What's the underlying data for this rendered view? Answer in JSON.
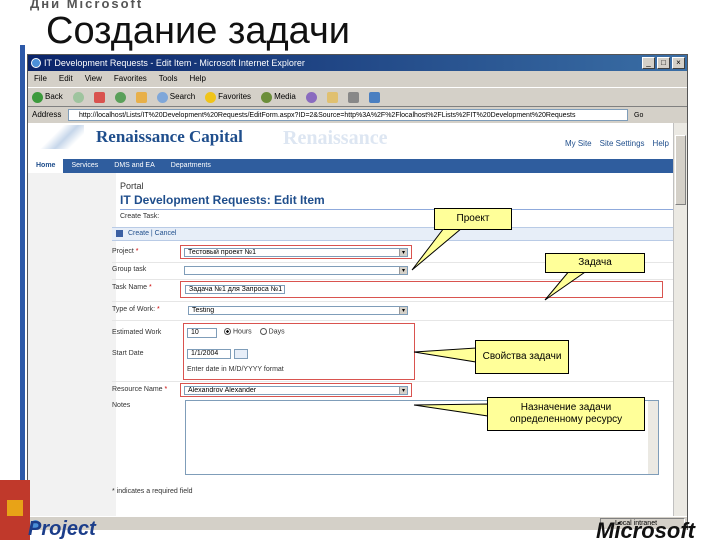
{
  "slide": {
    "header_small": "Дни Microsoft",
    "title": "Создание задачи",
    "footer_left": "Project",
    "footer_right": "Microsoft"
  },
  "browser": {
    "window_title": "IT Development Requests - Edit Item - Microsoft Internet Explorer",
    "menu": [
      "File",
      "Edit",
      "View",
      "Favorites",
      "Tools",
      "Help"
    ],
    "toolbar": [
      "Back",
      "",
      "",
      "",
      "",
      "Search",
      "Favorites",
      "Media",
      "",
      "",
      "",
      ""
    ],
    "address_label": "Address",
    "address_url": "http://localhost/Lists/IT%20Development%20Requests/EditForm.aspx?ID=2&Source=http%3A%2F%2Flocalhost%2FLists%2FIT%20Development%20Requests",
    "go_label": "Go",
    "status_text": "",
    "zone_text": "Local intranet"
  },
  "site": {
    "brand": "Renaissance Capital",
    "brand_shadow": "Renaissance",
    "util_links": [
      "My Site",
      "Site Settings",
      "Help"
    ],
    "nav": [
      "Home",
      "Services",
      "DMS and EA",
      "Departments"
    ],
    "portal": "Portal",
    "page_heading": "IT Development Requests: Edit Item",
    "create_task": "Create Task:",
    "save_bar": "Create | Cancel"
  },
  "form": {
    "project_label": "Project",
    "project_value": "Тестовый проект №1",
    "group_task_label": "Group task",
    "group_task_value": "",
    "task_name_label": "Task Name",
    "task_name_value": "Задача №1 для Запроса №1",
    "type_of_work_label": "Type of Work:",
    "type_of_work_value": "Testing",
    "estimated_work_label": "Estimated Work",
    "estimated_work_value": "10",
    "unit_hours": "Hours",
    "unit_days": "Days",
    "start_date_label": "Start Date",
    "start_date_value": "1/1/2004",
    "date_hint": "Enter date in M/D/YYYY format",
    "resource_name_label": "Resource Name",
    "resource_name_value": "Alexandrov Alexander",
    "notes_label": "Notes",
    "required_note": "* indicates a required field",
    "required_marker": "*"
  },
  "callouts": {
    "project": "Проект",
    "task": "Задача",
    "properties": "Свойства задачи",
    "assignment": "Назначение задачи определенному ресурсу"
  }
}
